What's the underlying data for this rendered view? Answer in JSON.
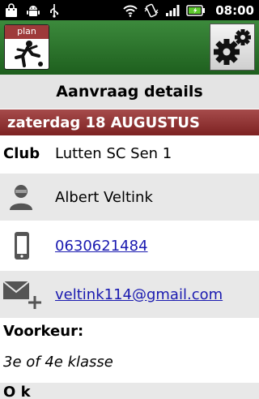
{
  "status_bar": {
    "time": "08:00",
    "icons": [
      "shopping-bag-icon",
      "android-icon",
      "usb-icon",
      "wifi-icon",
      "vibrate-icon",
      "signal-icon",
      "battery-icon"
    ],
    "battery_color": "#5ec92e"
  },
  "toolbar": {
    "plan_label": "plan",
    "plan_icon": "player-kick-icon",
    "settings_icon": "gears-icon",
    "accent": "#2f7a2f"
  },
  "page": {
    "title": "Aanvraag details",
    "date": "zaterdag 18 AUGUSTUS",
    "date_bar_color": "#8b2c2c"
  },
  "details": {
    "club_label": "Club",
    "club_value": "Lutten SC Sen 1",
    "contact_name": "Albert Veltink",
    "phone": "0630621484",
    "email": "veltink114@gmail.com",
    "preference_label": "Voorkeur:",
    "preference_value": "3e of 4e klasse",
    "next_label": "O    k"
  }
}
